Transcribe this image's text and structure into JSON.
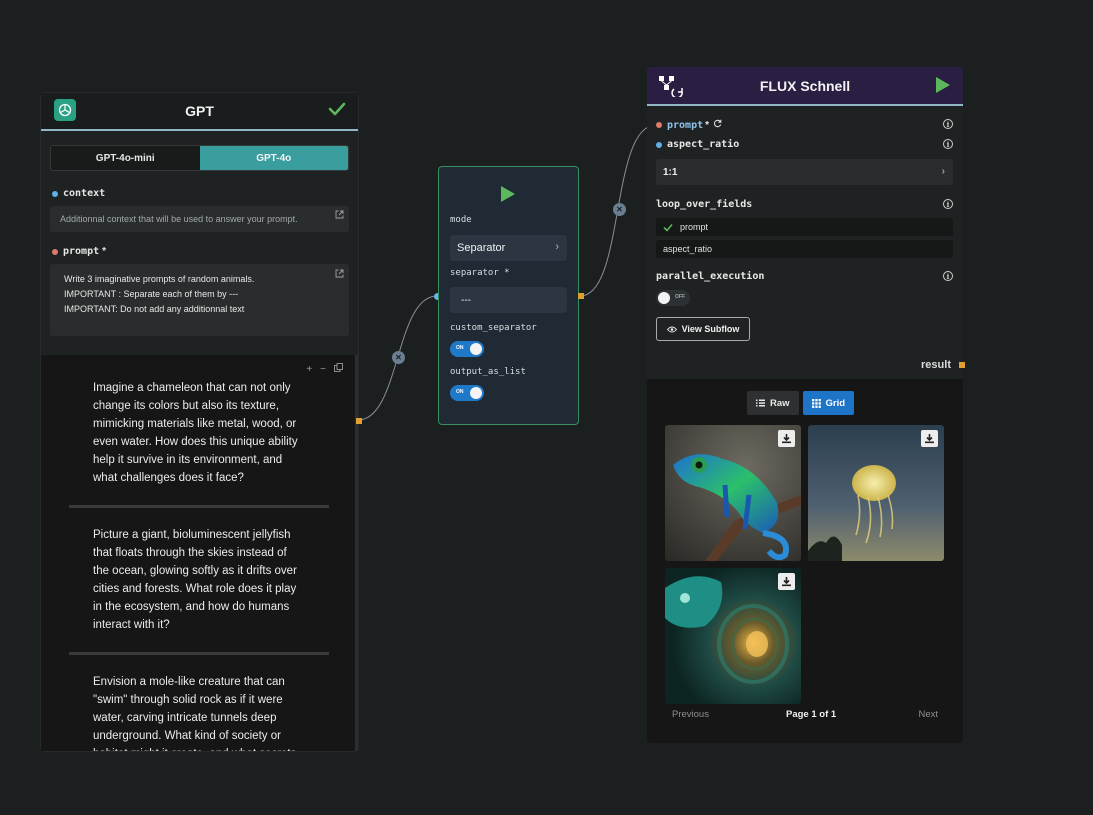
{
  "gpt_node": {
    "title": "GPT",
    "models": [
      "GPT-4o-mini",
      "GPT-4o"
    ],
    "active_model": "GPT-4o",
    "context_label": "context",
    "context_placeholder": "Additionnal context that will be used to answer your prompt.",
    "prompt_label": "prompt",
    "prompt_required": "*",
    "prompt_lines": [
      "Write 3 imaginative prompts of random animals.",
      "IMPORTANT : Separate each of them by ---",
      "IMPORTANT: Do not add any additionnal text"
    ],
    "output_tools": [
      "+",
      "−"
    ],
    "outputs": [
      "Imagine a chameleon that can not only change its colors but also its texture, mimicking materials like metal, wood, or even water. How does this unique ability help it survive in its environment, and what challenges does it face?",
      "Picture a giant, bioluminescent jellyfish that floats through the skies instead of the ocean, glowing softly as it drifts over cities and forests. What role does it play in the ecosystem, and how do humans interact with it?",
      "Envision a mole-like creature that can \"swim\" through solid rock as if it were water, carving intricate tunnels deep underground. What kind of society or habitat might it create, and what secrets of the Earth does it uncover?"
    ]
  },
  "splitter_node": {
    "mode_label": "mode",
    "mode_value": "Separator",
    "separator_label": "separator *",
    "separator_value": "---",
    "custom_separator_label": "custom_separator",
    "custom_separator_state": "ON",
    "output_as_list_label": "output_as_list",
    "output_as_list_state": "ON"
  },
  "flux_node": {
    "title": "FLUX Schnell",
    "prompt_label": "prompt",
    "prompt_suffix": "*",
    "aspect_ratio_label": "aspect_ratio",
    "aspect_ratio_value": "1:1",
    "loop_over_fields_label": "loop_over_fields",
    "loop_fields": [
      {
        "name": "prompt",
        "checked": true
      },
      {
        "name": "aspect_ratio",
        "checked": false
      }
    ],
    "parallel_execution_label": "parallel_execution",
    "parallel_execution_state": "OFF",
    "view_subflow_label": "View Subflow",
    "result_label": "result",
    "view_modes": [
      "Raw",
      "Grid"
    ],
    "active_view": "Grid",
    "pagination": {
      "previous": "Previous",
      "info": "Page 1 of 1",
      "next": "Next"
    }
  },
  "colors": {
    "canvas": "#1c1f1f",
    "accent_teal": "#3a9d9e",
    "accent_blue": "#1e75c7",
    "run_green": "#5cb85c",
    "flux_header": "#2a1f42",
    "port_orange": "#e0a030"
  }
}
